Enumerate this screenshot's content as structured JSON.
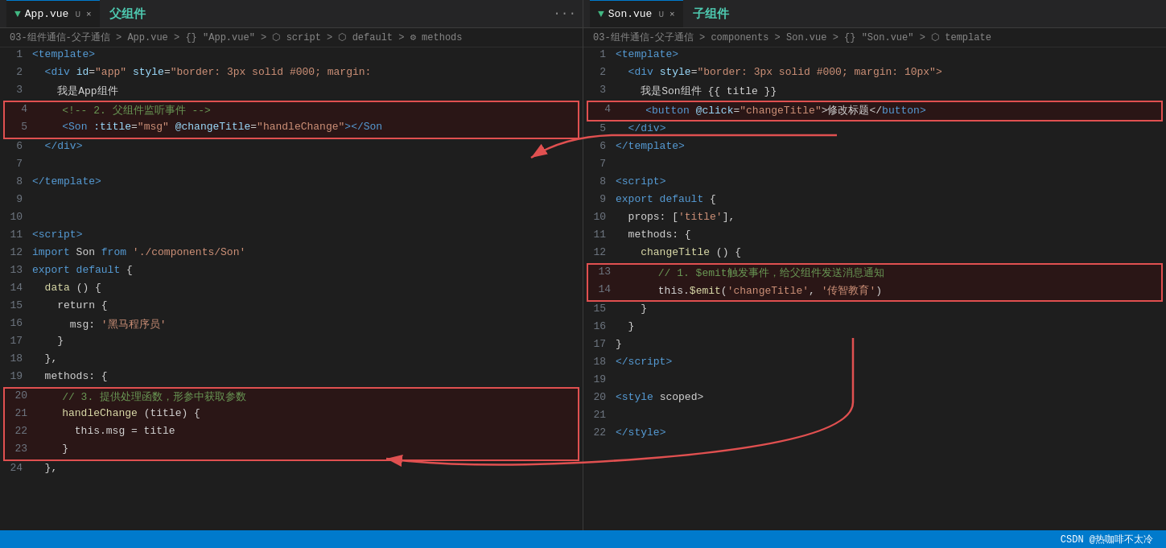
{
  "leftPane": {
    "tab": {
      "vue_icon": "▼",
      "filename": "App.vue",
      "modified": "U",
      "close": "×",
      "title_chinese": "父组件",
      "overflow": "···"
    },
    "breadcrumb": "03-组件通信-父子通信 > App.vue > {} \"App.vue\" > ⬡ script > ⬡ default > ⚙ methods",
    "lines": [
      {
        "num": 1,
        "tokens": [
          {
            "t": "<",
            "c": "c-tag"
          },
          {
            "t": "template",
            "c": "c-tag"
          },
          {
            "t": ">",
            "c": "c-tag"
          }
        ]
      },
      {
        "num": 2,
        "tokens": [
          {
            "t": "  <",
            "c": "c-tag"
          },
          {
            "t": "div",
            "c": "c-tag"
          },
          {
            "t": " ",
            "c": "c-white"
          },
          {
            "t": "id",
            "c": "c-attr"
          },
          {
            "t": "=",
            "c": "c-white"
          },
          {
            "t": "\"app\"",
            "c": "c-val"
          },
          {
            "t": " ",
            "c": "c-white"
          },
          {
            "t": "style",
            "c": "c-attr"
          },
          {
            "t": "=",
            "c": "c-white"
          },
          {
            "t": "\"border: 3px solid #000; margin:",
            "c": "c-val"
          }
        ]
      },
      {
        "num": 3,
        "tokens": [
          {
            "t": "    我是App组件",
            "c": "c-white"
          }
        ]
      },
      {
        "num": 4,
        "tokens": [
          {
            "t": "    ",
            "c": "c-white"
          },
          {
            "t": "<!-- 2. 父组件监听事件 -->",
            "c": "c-comment"
          }
        ],
        "highlight": true,
        "hltype": "top"
      },
      {
        "num": 5,
        "tokens": [
          {
            "t": "    ",
            "c": "c-white"
          },
          {
            "t": "<",
            "c": "c-tag"
          },
          {
            "t": "Son",
            "c": "c-tag"
          },
          {
            "t": " :title",
            "c": "c-attr"
          },
          {
            "t": "=",
            "c": "c-white"
          },
          {
            "t": "\"msg\"",
            "c": "c-val"
          },
          {
            "t": " @changeTitle",
            "c": "c-attr"
          },
          {
            "t": "=",
            "c": "c-white"
          },
          {
            "t": "\"handleChange\"",
            "c": "c-val"
          },
          {
            "t": "></",
            "c": "c-tag"
          },
          {
            "t": "Son",
            "c": "c-tag"
          }
        ],
        "highlight": true,
        "hltype": "bottom"
      },
      {
        "num": 6,
        "tokens": [
          {
            "t": "  </",
            "c": "c-tag"
          },
          {
            "t": "div",
            "c": "c-tag"
          },
          {
            "t": ">",
            "c": "c-tag"
          }
        ]
      },
      {
        "num": 7,
        "tokens": [
          {
            "t": "",
            "c": "c-white"
          }
        ]
      },
      {
        "num": 8,
        "tokens": [
          {
            "t": "</",
            "c": "c-tag"
          },
          {
            "t": "template",
            "c": "c-tag"
          },
          {
            "t": ">",
            "c": "c-tag"
          }
        ]
      },
      {
        "num": 9,
        "tokens": [
          {
            "t": "",
            "c": "c-white"
          }
        ]
      },
      {
        "num": 10,
        "tokens": [
          {
            "t": "",
            "c": "c-white"
          }
        ]
      },
      {
        "num": 11,
        "tokens": [
          {
            "t": "<",
            "c": "c-tag"
          },
          {
            "t": "script",
            "c": "c-tag"
          },
          {
            "t": ">",
            "c": "c-tag"
          }
        ]
      },
      {
        "num": 12,
        "tokens": [
          {
            "t": "import ",
            "c": "c-keyword"
          },
          {
            "t": "Son",
            "c": "c-white"
          },
          {
            "t": " from ",
            "c": "c-keyword"
          },
          {
            "t": "'./components/Son'",
            "c": "c-string"
          }
        ]
      },
      {
        "num": 13,
        "tokens": [
          {
            "t": "export ",
            "c": "c-keyword"
          },
          {
            "t": "default",
            "c": "c-keyword"
          },
          {
            "t": " {",
            "c": "c-white"
          }
        ]
      },
      {
        "num": 14,
        "tokens": [
          {
            "t": "  ",
            "c": "c-white"
          },
          {
            "t": "data",
            "c": "c-fn"
          },
          {
            "t": " () {",
            "c": "c-white"
          }
        ]
      },
      {
        "num": 15,
        "tokens": [
          {
            "t": "    return {",
            "c": "c-white"
          }
        ]
      },
      {
        "num": 16,
        "tokens": [
          {
            "t": "      msg: ",
            "c": "c-white"
          },
          {
            "t": "'黑马程序员'",
            "c": "c-string"
          }
        ]
      },
      {
        "num": 17,
        "tokens": [
          {
            "t": "    }",
            "c": "c-white"
          }
        ]
      },
      {
        "num": 18,
        "tokens": [
          {
            "t": "  },",
            "c": "c-white"
          }
        ]
      },
      {
        "num": 19,
        "tokens": [
          {
            "t": "  methods: {",
            "c": "c-white"
          }
        ]
      },
      {
        "num": 20,
        "tokens": [
          {
            "t": "    ",
            "c": "c-white"
          },
          {
            "t": "// 3. 提供处理函数，形参中获取参数",
            "c": "c-comment"
          }
        ],
        "highlight": true,
        "hltype": "top"
      },
      {
        "num": 21,
        "tokens": [
          {
            "t": "    ",
            "c": "c-fn"
          },
          {
            "t": "handleChange",
            "c": "c-fn"
          },
          {
            "t": " (title) {",
            "c": "c-white"
          }
        ],
        "highlight": true
      },
      {
        "num": 22,
        "tokens": [
          {
            "t": "      this.msg = title",
            "c": "c-white"
          }
        ],
        "highlight": true
      },
      {
        "num": 23,
        "tokens": [
          {
            "t": "    }",
            "c": "c-white"
          }
        ],
        "highlight": true,
        "hltype": "bottom"
      },
      {
        "num": 24,
        "tokens": [
          {
            "t": "  },",
            "c": "c-white"
          }
        ]
      }
    ]
  },
  "rightPane": {
    "tab": {
      "vue_icon": "▼",
      "filename": "Son.vue",
      "modified": "U",
      "close": "×",
      "title_chinese": "子组件",
      "overflow": ""
    },
    "breadcrumb": "03-组件通信-父子通信 > components > Son.vue > {} \"Son.vue\" > ⬡ template",
    "lines": [
      {
        "num": 1,
        "tokens": [
          {
            "t": "<",
            "c": "c-tag"
          },
          {
            "t": "template",
            "c": "c-tag"
          },
          {
            "t": ">",
            "c": "c-tag"
          }
        ]
      },
      {
        "num": 2,
        "tokens": [
          {
            "t": "  <",
            "c": "c-tag"
          },
          {
            "t": "div",
            "c": "c-tag"
          },
          {
            "t": " ",
            "c": "c-white"
          },
          {
            "t": "style",
            "c": "c-attr"
          },
          {
            "t": "=",
            "c": "c-white"
          },
          {
            "t": "\"border: 3px solid #000; margin: 10px\">",
            "c": "c-val"
          }
        ]
      },
      {
        "num": 3,
        "tokens": [
          {
            "t": "    我是Son组件 {{ title }}",
            "c": "c-white"
          }
        ]
      },
      {
        "num": 4,
        "tokens": [
          {
            "t": "    ",
            "c": "c-white"
          },
          {
            "t": "<",
            "c": "c-tag"
          },
          {
            "t": "button",
            "c": "c-tag"
          },
          {
            "t": " @click",
            "c": "c-attr"
          },
          {
            "t": "=",
            "c": "c-white"
          },
          {
            "t": "\"changeTitle\"",
            "c": "c-val"
          },
          {
            "t": ">修改标题</",
            "c": "c-white"
          },
          {
            "t": "button",
            "c": "c-tag"
          },
          {
            "t": ">",
            "c": "c-tag"
          }
        ],
        "highlight": true,
        "hltype": "single"
      },
      {
        "num": 5,
        "tokens": [
          {
            "t": "  </",
            "c": "c-tag"
          },
          {
            "t": "div",
            "c": "c-tag"
          },
          {
            "t": ">",
            "c": "c-tag"
          }
        ]
      },
      {
        "num": 6,
        "tokens": [
          {
            "t": "</",
            "c": "c-tag"
          },
          {
            "t": "template",
            "c": "c-tag"
          },
          {
            "t": ">",
            "c": "c-tag"
          }
        ]
      },
      {
        "num": 7,
        "tokens": [
          {
            "t": "",
            "c": "c-white"
          }
        ]
      },
      {
        "num": 8,
        "tokens": [
          {
            "t": "<",
            "c": "c-tag"
          },
          {
            "t": "script",
            "c": "c-tag"
          },
          {
            "t": ">",
            "c": "c-tag"
          }
        ]
      },
      {
        "num": 9,
        "tokens": [
          {
            "t": "export ",
            "c": "c-keyword"
          },
          {
            "t": "default",
            "c": "c-keyword"
          },
          {
            "t": " {",
            "c": "c-white"
          }
        ]
      },
      {
        "num": 10,
        "tokens": [
          {
            "t": "  props: [",
            "c": "c-white"
          },
          {
            "t": "'title'",
            "c": "c-string"
          },
          {
            "t": "],",
            "c": "c-white"
          }
        ]
      },
      {
        "num": 11,
        "tokens": [
          {
            "t": "  methods: {",
            "c": "c-white"
          }
        ]
      },
      {
        "num": 12,
        "tokens": [
          {
            "t": "    ",
            "c": "c-fn"
          },
          {
            "t": "changeTitle",
            "c": "c-fn"
          },
          {
            "t": " () {",
            "c": "c-white"
          }
        ]
      },
      {
        "num": 13,
        "tokens": [
          {
            "t": "      ",
            "c": "c-white"
          },
          {
            "t": "// 1. $emit触发事件，给父组件发送消息通知",
            "c": "c-comment"
          }
        ],
        "highlight": true,
        "hltype": "top"
      },
      {
        "num": 14,
        "tokens": [
          {
            "t": "      this.",
            "c": "c-white"
          },
          {
            "t": "$emit",
            "c": "c-fn"
          },
          {
            "t": "(",
            "c": "c-white"
          },
          {
            "t": "'changeTitle'",
            "c": "c-string"
          },
          {
            "t": ", ",
            "c": "c-white"
          },
          {
            "t": "'传智教育'",
            "c": "c-string"
          },
          {
            "t": ")",
            "c": "c-white"
          }
        ],
        "highlight": true,
        "hltype": "bottom"
      },
      {
        "num": 15,
        "tokens": [
          {
            "t": "    }",
            "c": "c-white"
          }
        ]
      },
      {
        "num": 16,
        "tokens": [
          {
            "t": "  }",
            "c": "c-white"
          }
        ]
      },
      {
        "num": 17,
        "tokens": [
          {
            "t": "}",
            "c": "c-white"
          }
        ]
      },
      {
        "num": 18,
        "tokens": [
          {
            "t": "</",
            "c": "c-tag"
          },
          {
            "t": "script",
            "c": "c-tag"
          },
          {
            "t": ">",
            "c": "c-tag"
          }
        ]
      },
      {
        "num": 19,
        "tokens": [
          {
            "t": "",
            "c": "c-white"
          }
        ]
      },
      {
        "num": 20,
        "tokens": [
          {
            "t": "<",
            "c": "c-tag"
          },
          {
            "t": "style",
            "c": "c-tag"
          },
          {
            "t": " scoped>",
            "c": "c-white"
          }
        ]
      },
      {
        "num": 21,
        "tokens": [
          {
            "t": "",
            "c": "c-white"
          }
        ]
      },
      {
        "num": 22,
        "tokens": [
          {
            "t": "</",
            "c": "c-tag"
          },
          {
            "t": "style",
            "c": "c-tag"
          },
          {
            "t": ">",
            "c": "c-tag"
          }
        ]
      }
    ]
  },
  "statusBar": {
    "text": "CSDN @热咖啡不太冷"
  }
}
